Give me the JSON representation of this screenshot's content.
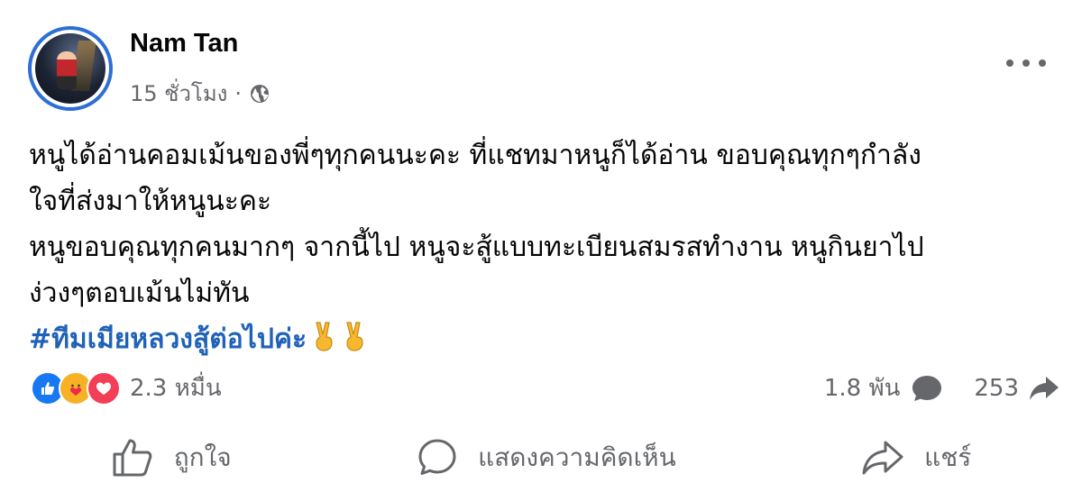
{
  "post": {
    "author": "Nam Tan",
    "time": "15 ชั่วโมง",
    "separator": "·",
    "privacy_icon": "globe-icon",
    "menu_icon": "more-dots-icon"
  },
  "content": {
    "lines": [
      "หนูได้อ่านคอมเม้นของพี่ๆทุกคนนะคะ ที่แชทมาหนูก็ได้อ่าน ขอบคุณทุกๆกำลัง",
      "ใจที่ส่งมาให้หนูนะคะ",
      "หนูขอบคุณทุกคนมากๆ จากนี้ไป หนูจะสู้แบบทะเบียนสมรสทำงาน หนูกินยาไป",
      "ง่วงๆตอบเม้นไม่ทัน"
    ],
    "hashtag": "#ทีมเมียหลวงสู้ต่อไปค่ะ",
    "emoji_icons": [
      "victory-hand-icon",
      "victory-hand-icon"
    ]
  },
  "reactions": {
    "types": [
      "like-icon",
      "care-icon",
      "love-icon"
    ],
    "count": "2.3 หมื่น"
  },
  "stats": {
    "comments": "1.8 พัน",
    "shares": "253"
  },
  "actions": {
    "like_label": "ถูกใจ",
    "comment_label": "แสดงความคิดเห็น",
    "share_label": "แชร์"
  },
  "colors": {
    "avatar_ring": "#2d6fd6",
    "hashtag": "#1f62b8",
    "secondary_text": "#65676b",
    "like": "#1877f2",
    "care": "#f7b125",
    "love": "#f33e58"
  }
}
